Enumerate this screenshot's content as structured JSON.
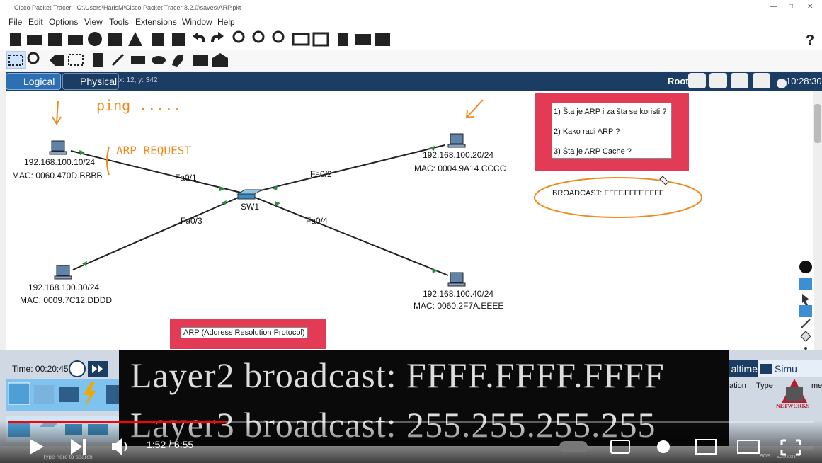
{
  "window": {
    "title": "Cisco Packet Tracer - C:\\Users\\HarisM\\Cisco Packet Tracer 8.2.0\\saves\\ARP.pkt"
  },
  "menu": [
    "File",
    "Edit",
    "Options",
    "View",
    "Tools",
    "Extensions",
    "Window",
    "Help"
  ],
  "tabs": {
    "logical": "Logical",
    "physical": "Physical",
    "coords": "x: 12, y: 342",
    "root": "Root",
    "clock": "10:28:30"
  },
  "devices": {
    "pc0": {
      "ip": "192.168.100.10/24",
      "mac": "MAC: 0060.470D.BBBB"
    },
    "pc1": {
      "ip": "192.168.100.20/24",
      "mac": "MAC: 0004.9A14.CCCC"
    },
    "pc2": {
      "ip": "192.168.100.30/24",
      "mac": "MAC: 0009.7C12.DDDD"
    },
    "pc3": {
      "ip": "192.168.100.40/24",
      "mac": "MAC: 0060.2F7A.EEEE"
    },
    "switch": "SW1"
  },
  "ports": {
    "fa01": "Fa0/1",
    "fa02": "Fa0/2",
    "fa03": "Fa0/3",
    "fa04": "Fa0/4"
  },
  "annotations": {
    "ping": "ping .....",
    "arp_request": "ARP REQUEST",
    "broadcast": "BROADCAST: FFFF.FFFF.FFFF"
  },
  "questions": [
    "1) Šta je ARP i za šta se koristi ?",
    "2) Kako radi ARP ?",
    "3) Šta je ARP Cache ?"
  ],
  "arp_label": "ARP (Address Resolution Protocol)",
  "bottom": {
    "time": "Time: 00:20:45",
    "realtime": "altime",
    "simulation": "Simu",
    "cols": [
      "ation",
      "Type",
      "me"
    ]
  },
  "subtitle": {
    "line1": "Layer2 broadcast: FFFF.FFFF.FFFF",
    "line2": "Layer3 broadcast: 255.255.255.255"
  },
  "player": {
    "time": "1:52 / 6:55",
    "progress": 0.27
  },
  "taskbar": {
    "search": "Type here to search",
    "lang": "BOS",
    "date": "5/20/2023"
  },
  "logo": {
    "text": "NETWORKS"
  },
  "colors": {
    "tabbar": "#1b3d63",
    "redbox": "#e33b55",
    "orange": "#f08a1c",
    "link": "#2a8f3a"
  }
}
